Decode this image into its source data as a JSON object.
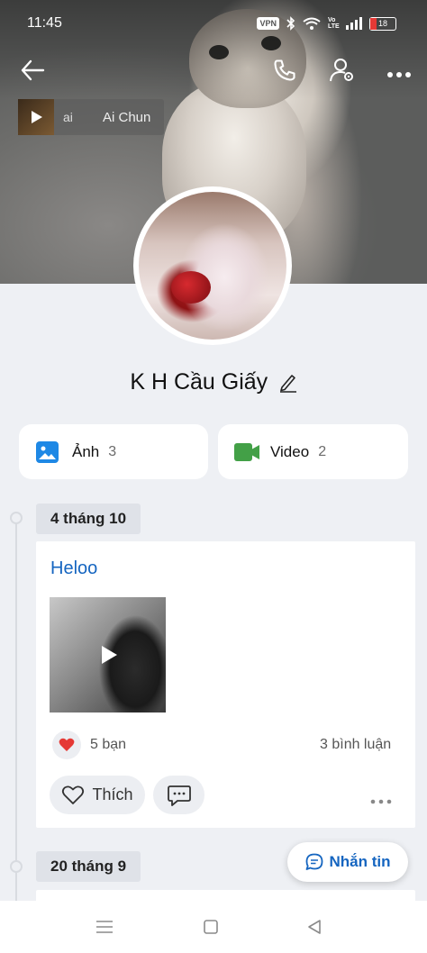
{
  "status_bar": {
    "time": "11:45",
    "vpn": "VPN",
    "volte": "Vo LTE",
    "battery": "18"
  },
  "music": {
    "title_fragment": "ai",
    "artist": "Ai Chun"
  },
  "profile": {
    "name": "K H Cầu Giấy"
  },
  "media": {
    "photos": {
      "label": "Ảnh",
      "count": "3"
    },
    "videos": {
      "label": "Video",
      "count": "2"
    }
  },
  "timeline": [
    {
      "date": "4 tháng 10",
      "title": "Heloo",
      "likes": "5 bạn",
      "comments": "3 bình luận",
      "like_label": "Thích"
    },
    {
      "date": "20 tháng 9"
    }
  ],
  "fab": {
    "label": "Nhắn tin"
  },
  "colors": {
    "accent": "#1565c0",
    "photo_icon": "#1e88e5",
    "video_icon": "#43a047",
    "heart": "#e53935"
  }
}
